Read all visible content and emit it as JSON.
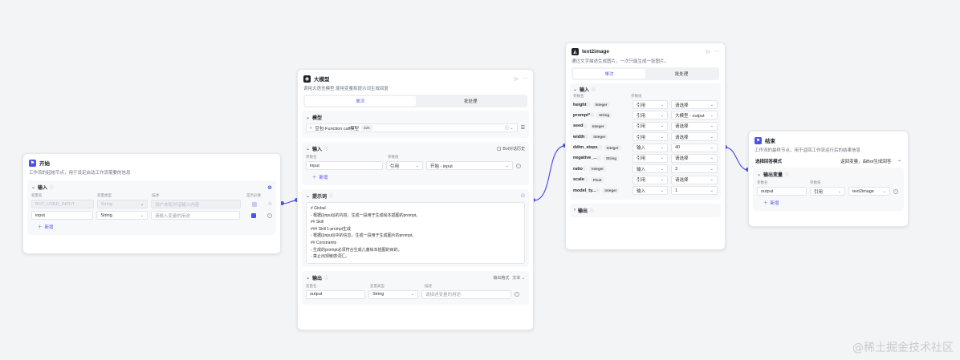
{
  "start": {
    "title": "开始",
    "desc": "工作流的起始节点，用于设定启动工作流需要的信息",
    "input_label": "输入",
    "col_heads": [
      "变量名",
      "变量类型",
      "描述",
      "是否必要"
    ],
    "rows": [
      {
        "name": "BOT_USER_INPUT",
        "type": "String",
        "desc": "用户本轮对话输入内容",
        "disabled": true
      },
      {
        "name": "input",
        "type": "String",
        "desc": "请输入变量的用途",
        "disabled": false
      }
    ],
    "add_label": "新增"
  },
  "llm": {
    "title": "大模型",
    "desc": "调用大语言模型,使用变量和提示词生成回复",
    "tabs": [
      "单次",
      "批处理"
    ],
    "model_label": "模型",
    "model_name": "豆包·Function call模型",
    "model_ctx": "32K",
    "input_label": "输入",
    "bot_history": "Bot对话历史",
    "col_heads": [
      "参数名",
      "参数值"
    ],
    "input_row": {
      "name": "input",
      "mode": "引用",
      "value": "开始 - input"
    },
    "add_label": "新增",
    "prompt_label": "提示词",
    "prompt_lines": [
      "# Global",
      "- 根据{{input}}的内容，生成一段用于生成绘本插图的prompt。",
      "## Skill",
      "### Skill 1:prompt生成",
      "- 根据{{input}}中的信息，生成一段用于生成图片的prompt。",
      "## Constraints",
      "- 生成的prompt必须符合生成儿童绘本插图的目的。",
      "- 禁止出现敏感词汇。"
    ],
    "output_label": "输出",
    "output_format_label": "输出格式",
    "output_format": "文本",
    "out_col_heads": [
      "变量名",
      "变量类型",
      "描述"
    ],
    "output_row": {
      "name": "output",
      "type": "String",
      "desc": "请描述变量的用途"
    }
  },
  "t2i": {
    "title": "text2image",
    "desc": "通过文字描述生成图片，一次只能生成一张图片。",
    "tabs": [
      "单次",
      "批处理"
    ],
    "input_label": "输入",
    "col_heads": [
      "参数名",
      "参数值"
    ],
    "rows": [
      {
        "name": "height",
        "type": "Integer",
        "mode": "引用",
        "value": "请选择"
      },
      {
        "name": "prompt*",
        "type": "String",
        "mode": "引用",
        "value": "大模型 - output"
      },
      {
        "name": "seed",
        "type": "Integer",
        "mode": "引用",
        "value": "请选择"
      },
      {
        "name": "width",
        "type": "Integer",
        "mode": "引用",
        "value": "请选择"
      },
      {
        "name": "ddim_steps",
        "type": "Integer",
        "mode": "输入",
        "value": "40"
      },
      {
        "name": "negative_...",
        "type": "String",
        "mode": "引用",
        "value": "请选择"
      },
      {
        "name": "ratio",
        "type": "Integer",
        "mode": "输入",
        "value": "3"
      },
      {
        "name": "scale",
        "type": "Float",
        "mode": "引用",
        "value": "请选择"
      },
      {
        "name": "model_ty...",
        "type": "Integer",
        "mode": "输入",
        "value": "1"
      }
    ],
    "output_label": "输出"
  },
  "end": {
    "title": "结束",
    "desc": "工作流的最终节点，用于返回工作流运行后的结果信息",
    "mode_label": "选择回答模式",
    "mode_value": "返回变量，由Bot生成回答",
    "output_label": "输出变量",
    "col_heads": [
      "参数名",
      "参数值"
    ],
    "row": {
      "name": "output",
      "mode": "引用",
      "value": "text2image"
    },
    "add_label": "新增"
  },
  "watermark": "@稀土掘金技术社区",
  "colors": {
    "accent": "#4d53e8",
    "canvas": "#f3f4f6"
  }
}
